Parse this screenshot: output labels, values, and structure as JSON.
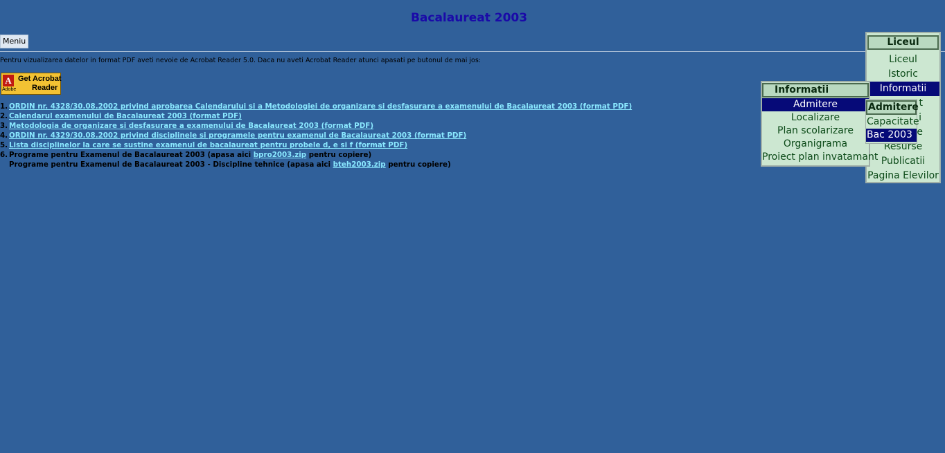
{
  "page": {
    "title": "Bacalaureat 2003",
    "menu_button": "Meniu",
    "info_text": "Pentru vizualizarea datelor in format PDF aveti nevoie de Acrobat Reader 5.0. Daca nu aveti Acrobat Reader atunci apasati pe butonul de mai jos:",
    "acrobat": {
      "logo_letter": "A",
      "brand": "Adobe",
      "line1": "Get Acrobat",
      "line2": "Reader"
    }
  },
  "documents": [
    {
      "num": "1.",
      "link": "ORDIN nr. 4328/30.08.2002 privind aprobarea Calendarului si a Metodologiei de organizare si desfasurare a examenului de Bacalaureat 2003 (format PDF)"
    },
    {
      "num": "2.",
      "link": "Calendarul examenului de Bacalaureat 2003 (format PDF)"
    },
    {
      "num": "3.",
      "link": "Metodologia de organizare si desfasurare a examenului de Bacalaureat 2003 (format PDF)"
    },
    {
      "num": "4.",
      "link": "ORDIN nr. 4329/30.08.2002 privind disciplinele si programele pentru examenul de Bacalaureat 2003 (format PDF)"
    },
    {
      "num": "5.",
      "link": "Lista disciplinelor la care se sustine examenul de bacalaureat pentru probele d, e si f (format PDF)"
    }
  ],
  "downloads": {
    "row1": {
      "num": "6.",
      "before": "Programe pentru Examenul de Bacalaureat 2003 (apasa aici ",
      "link": "bpro2003.zip",
      "after": " pentru copiere)"
    },
    "row2": {
      "before": "Programe pentru Examenul de Bacalaureat 2003 - Discipline tehnice (apasa aici ",
      "link": "bteh2003.zip",
      "after": " pentru copiere)"
    }
  },
  "menus": {
    "liceul": {
      "header": "Liceul",
      "items": [
        "Liceul",
        "Istoric",
        "Informatii",
        "t",
        "i",
        "e",
        "Resurse",
        "Publicatii",
        "Pagina Elevilor"
      ]
    },
    "informatii": {
      "header": "Informatii",
      "items": [
        "Admitere",
        "Localizare",
        "Plan scolarizare",
        "Organigrama",
        "Proiect plan invatamant"
      ]
    },
    "admitere": {
      "header": "Admitere",
      "items": [
        "Capacitate",
        "Bac 2003"
      ]
    }
  },
  "colors": {
    "background": "#30609a",
    "title": "#1a0aa8",
    "link": "#8ae8ff",
    "menu_bg": "#cce7d1",
    "menu_active": "#060a78"
  }
}
